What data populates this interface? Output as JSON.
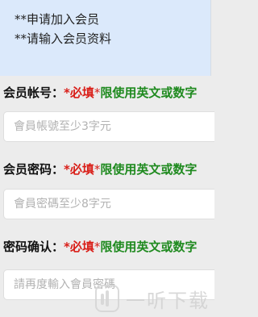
{
  "notice": {
    "line1": "**申请加入会员",
    "line2": "**请输入会员资料"
  },
  "fields": [
    {
      "name": "会员帐号：",
      "required": "*必填",
      "star": "*",
      "rule": "限使用英文或数字",
      "placeholder": "會員帳號至少3字元",
      "value": ""
    },
    {
      "name": "会员密码：",
      "required": "*必填",
      "star": "*",
      "rule": "限使用英文或数字",
      "placeholder": "會員密碼至少8字元",
      "value": ""
    },
    {
      "name": "密码确认：",
      "required": "*必填",
      "star": "*",
      "rule": "限使用英文或数字",
      "placeholder": "請再度輸入會員密碼",
      "value": ""
    }
  ],
  "watermark": {
    "text": "一听下载"
  },
  "colors": {
    "notice_bg": "#dbe9fb",
    "required_red": "#d91e18",
    "rule_green": "#1f8a1f",
    "page_bg": "#ececec"
  }
}
